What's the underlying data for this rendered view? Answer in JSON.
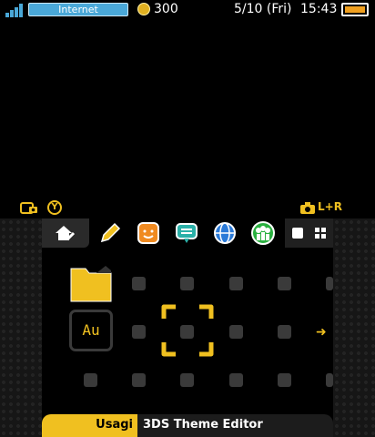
{
  "status_bar": {
    "connection": "Internet",
    "coins": "300",
    "date": "5/10 (Fri)",
    "time": "15:43"
  },
  "hints": {
    "y_button": "Y",
    "screenshot_combo": "L+R"
  },
  "toolbar": {
    "icons": [
      "home-settings-icon",
      "pencil-icon",
      "face-icon",
      "chat-icon",
      "globe-icon",
      "friends-icon",
      "grid-large-icon",
      "grid-small-icon"
    ]
  },
  "grid": {
    "folder_icon": "folder-icon",
    "app_label": "Au"
  },
  "footer": {
    "title": "Usagi",
    "subtitle": "3DS Theme Editor"
  },
  "colors": {
    "accent": "#f0c020",
    "internet": "#4aa8d8",
    "battery": "#f0a020"
  }
}
